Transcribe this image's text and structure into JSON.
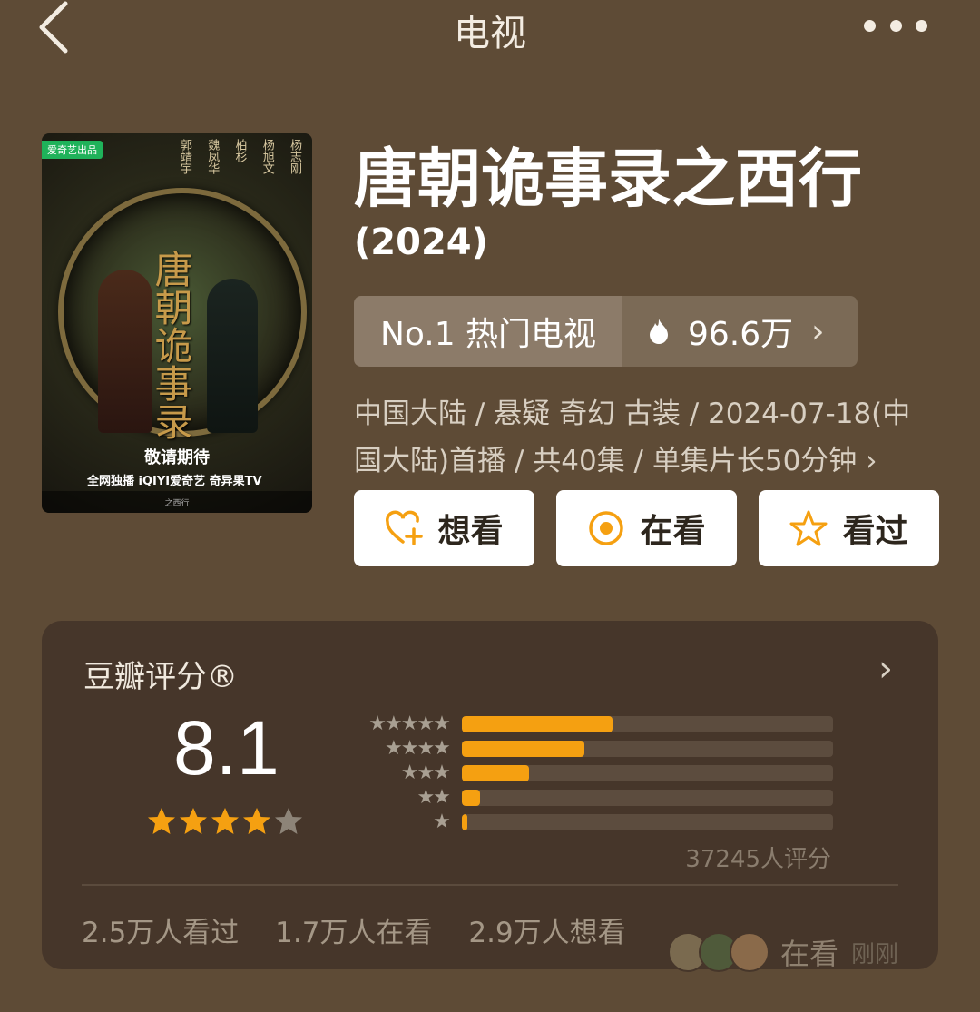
{
  "topbar": {
    "title": "电视"
  },
  "poster": {
    "tag_production": "爱奇艺出品",
    "tag_studio": "",
    "cast": [
      "杨志刚",
      "杨旭文",
      "柏杉",
      "魏凤华",
      "郭靖宇"
    ],
    "calligraphy": "唐朝诡事录",
    "subtitle": "之西行",
    "expect_text": "敬请期待",
    "platform_text": "全网独播 iQIYI爱奇艺  奇异果TV"
  },
  "movie": {
    "title": "唐朝诡事录之西行",
    "year": "(2024)",
    "rank_label": "No.1 热门电视",
    "heat": "96.6万",
    "meta": "中国大陆 / 悬疑 奇幻 古装 / 2024-07-18(中国大陆)首播 / 共40集 / 单集片长50分钟 ›"
  },
  "actions": {
    "want": "想看",
    "watching": "在看",
    "watched": "看过"
  },
  "rating": {
    "title": "豆瓣评分®",
    "score": "8.1",
    "stars_value": 4,
    "stars_max": 5,
    "distribution": [
      {
        "stars": "★★★★★",
        "fraction": 0.405
      },
      {
        "stars": "★★★★",
        "fraction": 0.33
      },
      {
        "stars": "★★★",
        "fraction": 0.18
      },
      {
        "stars": "★★",
        "fraction": 0.05
      },
      {
        "stars": "★",
        "fraction": 0.015
      }
    ],
    "count_text": "37245人评分",
    "stats": [
      "2.5万人看过",
      "1.7万人在看",
      "2.9万人想看"
    ],
    "activity_label": "在看",
    "activity_time": "刚刚"
  },
  "colors": {
    "background": "#5e4b36",
    "card": "#46362a",
    "accent": "#f5a011",
    "rank_left": "#8c7b69",
    "rank_right": "#7b6a56"
  }
}
